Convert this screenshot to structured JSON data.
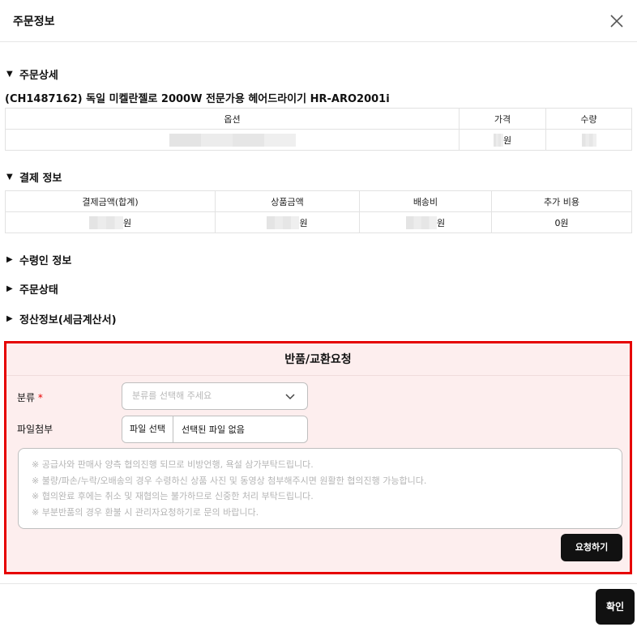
{
  "modal": {
    "title": "주문정보",
    "confirm_label": "확인"
  },
  "order_detail": {
    "heading": "주문상세",
    "product_name": "(CH1487162) 독일 미켈란젤로 2000W 전문가용 헤어드라이기 HR-ARO2001i",
    "columns": [
      "옵션",
      "가격",
      "수량"
    ],
    "price_unit": "원"
  },
  "payment": {
    "heading": "결제 정보",
    "columns": [
      "결제금액(합계)",
      "상품금액",
      "배송비",
      "추가 비용"
    ],
    "unit": "원",
    "extra_cost": "0원"
  },
  "collapsed_sections": [
    "수령인 정보",
    "주문상태",
    "정산정보(세금계산서)"
  ],
  "return_request": {
    "title": "반품/교환요청",
    "category_label": "분류",
    "required_mark": "*",
    "category_placeholder": "분류를 선택해 주세요",
    "attachment_label": "파일첨부",
    "file_button": "파일 선택",
    "file_status": "선택된 파일 없음",
    "notices": [
      "※ 공급사와 판매사 양측 협의진행 되므로 비방언행, 욕설 삼가부탁드립니다.",
      "※ 불량/파손/누락/오배송의 경우 수령하신 상품 사진 및 동영상 첨부해주시면 원활한 협의진행 가능합니다.",
      "※ 협의완료 후에는 취소 및 재협의는 불가하므로 신중한 처리 부탁드립니다.",
      "※ 부분반품의 경우 환불 시 관리자요청하기로 문의 바랍니다."
    ],
    "submit_label": "요청하기"
  },
  "colors": {
    "highlight_border": "#e60000",
    "panel_background": "#fdeeee",
    "button_dark": "#111111"
  },
  "icons": {
    "close": "close-icon",
    "expanded": "triangle-down-icon",
    "collapsed": "triangle-right-icon",
    "dropdown": "chevron-down-icon"
  }
}
